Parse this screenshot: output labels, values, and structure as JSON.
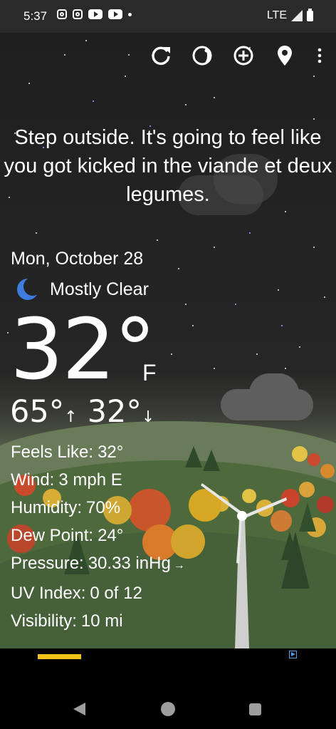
{
  "status_bar": {
    "time": "5:37",
    "network": "LTE"
  },
  "toolbar": {
    "icons": [
      "refresh-icon",
      "theme-icon",
      "add-location-icon",
      "location-pin-icon",
      "more-vert-icon"
    ]
  },
  "headline": "Step outside. It's going to feel like you got kicked in the viande et deux legumes.",
  "weather": {
    "date": "Mon, October 28",
    "condition": "Mostly Clear",
    "condition_icon": "moon-icon",
    "temperature": "32°",
    "unit": "F",
    "high": "65°",
    "high_arrow": "↑",
    "low": "32°",
    "low_arrow": "↓"
  },
  "details": [
    {
      "label": "Feels Like:",
      "value": "32°"
    },
    {
      "label": "Wind:",
      "value": "3 mph E"
    },
    {
      "label": "Humidity:",
      "value": "70%"
    },
    {
      "label": "Dew Point:",
      "value": "24°"
    },
    {
      "label": "Pressure:",
      "value": "30.33 inHg",
      "trend": "→"
    },
    {
      "label": "UV Index:",
      "value": "0 of 12"
    },
    {
      "label": "Visibility:",
      "value": "10 mi"
    }
  ],
  "colors": {
    "ad_accent": "#f2c21b",
    "moon": "#3f7ce0",
    "sky": "#1f1f1f"
  }
}
